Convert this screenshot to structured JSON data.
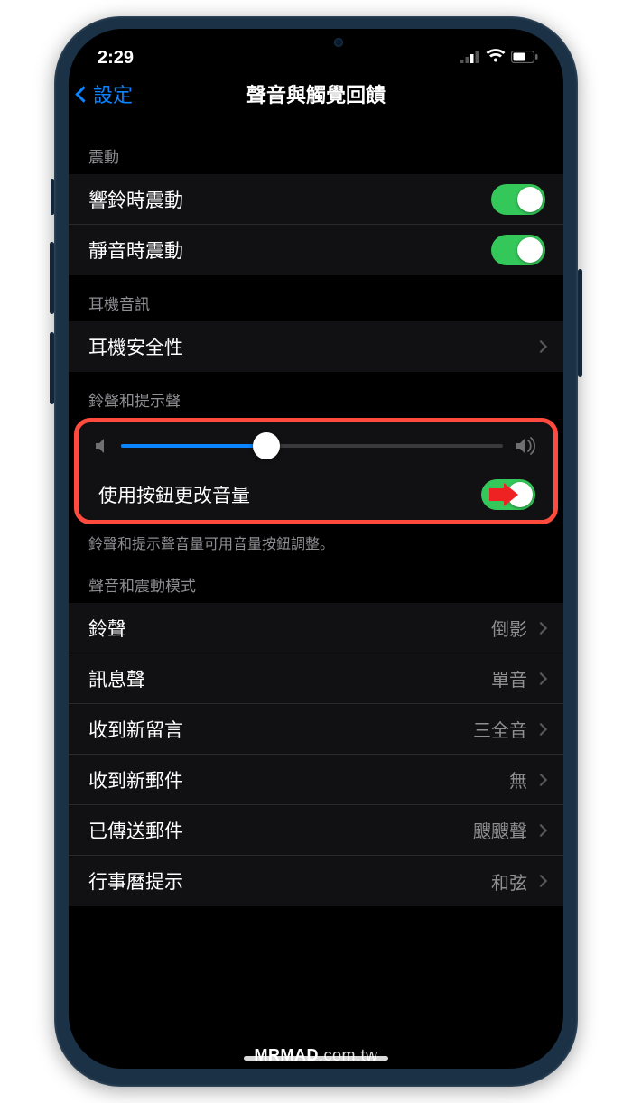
{
  "status": {
    "time": "2:29"
  },
  "nav": {
    "back_label": "設定",
    "title": "聲音與觸覺回饋"
  },
  "sections": {
    "vibrate": {
      "header": "震動",
      "ring": "響鈴時震動",
      "silent": "靜音時震動"
    },
    "headphone": {
      "header": "耳機音訊",
      "safety": "耳機安全性"
    },
    "ringer": {
      "header": "鈴聲和提示聲",
      "change_with_buttons": "使用按鈕更改音量",
      "footer": "鈴聲和提示聲音量可用音量按鈕調整。",
      "slider_value_percent": 38
    },
    "patterns": {
      "header": "聲音和震動模式",
      "items": [
        {
          "label": "鈴聲",
          "value": "倒影"
        },
        {
          "label": "訊息聲",
          "value": "單音"
        },
        {
          "label": "收到新留言",
          "value": "三全音"
        },
        {
          "label": "收到新郵件",
          "value": "無"
        },
        {
          "label": "已傳送郵件",
          "value": "颼颼聲"
        },
        {
          "label": "行事曆提示",
          "value": "和弦"
        }
      ]
    }
  },
  "watermark": {
    "bold": "MRMAD",
    "rest": ".com.tw"
  }
}
